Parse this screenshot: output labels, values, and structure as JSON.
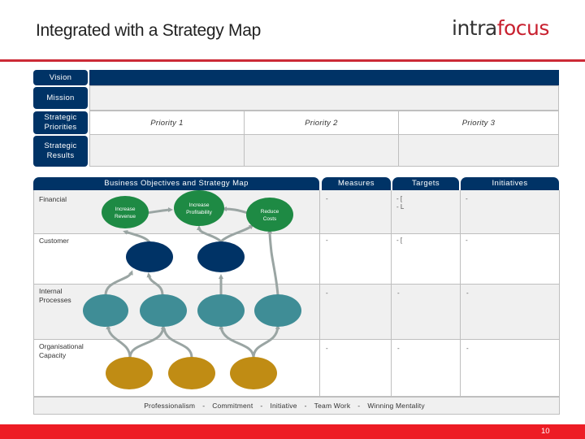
{
  "header": {
    "title": "Integrated with a Strategy Map",
    "logo_part1": "intra",
    "logo_part2": "focus"
  },
  "colors": {
    "navy": "#003366",
    "green": "#1e8a44",
    "teal": "#3f8d96",
    "gold": "#c08c14",
    "arrow": "#9aa5a3",
    "brand_red": "#ed1c24"
  },
  "framework": {
    "vision_label": "Vision",
    "mission_label": "Mission",
    "priorities_label": "Strategic Priorities",
    "results_label": "Strategic Results",
    "priorities": [
      "Priority 1",
      "Priority 2",
      "Priority 3"
    ]
  },
  "table": {
    "headers": {
      "map": "Business Objectives and Strategy Map",
      "measures": "Measures",
      "targets": "Targets",
      "initiatives": "Initiatives"
    },
    "rows": [
      {
        "perspective": "Financial",
        "measures": "-",
        "targets": [
          "- [",
          "- L"
        ],
        "initiatives": "-"
      },
      {
        "perspective": "Customer",
        "measures": "-",
        "targets": [
          "- ["
        ],
        "initiatives": "-"
      },
      {
        "perspective": "Internal Processes",
        "measures": "-",
        "targets": [
          "-"
        ],
        "initiatives": "-"
      },
      {
        "perspective": "Organisational Capacity",
        "measures": "-",
        "targets": [
          "-"
        ],
        "initiatives": "-"
      }
    ]
  },
  "strategy_map": {
    "financial_nodes": [
      {
        "label_line1": "Increase",
        "label_line2": "Revenue"
      },
      {
        "label_line1": "Increase",
        "label_line2": "Profitability"
      },
      {
        "label_line1": "Reduce",
        "label_line2": "Costs"
      }
    ],
    "customer_nodes": 2,
    "internal_nodes": 4,
    "capacity_nodes": 3
  },
  "values": [
    "Professionalism",
    "Commitment",
    "Initiative",
    "Team Work",
    "Winning Mentality"
  ],
  "values_separator": "-",
  "page_number": "10"
}
